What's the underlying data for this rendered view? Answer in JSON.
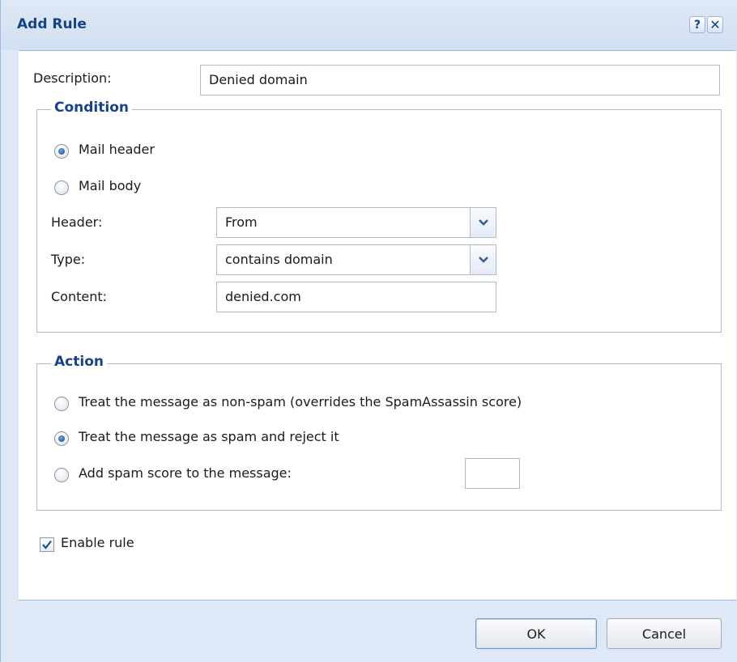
{
  "dialog": {
    "title": "Add Rule",
    "help_glyph": "?",
    "close_glyph": "✕"
  },
  "description": {
    "label": "Description:",
    "value": "Denied domain"
  },
  "condition": {
    "legend": "Condition",
    "options": [
      {
        "label": "Mail header",
        "selected": true
      },
      {
        "label": "Mail body",
        "selected": false
      }
    ],
    "header": {
      "label": "Header:",
      "value": "From"
    },
    "type": {
      "label": "Type:",
      "value": "contains domain"
    },
    "content": {
      "label": "Content:",
      "value": "denied.com"
    }
  },
  "action": {
    "legend": "Action",
    "options": [
      {
        "label": "Treat the message as non-spam (overrides the SpamAssassin score)",
        "selected": false
      },
      {
        "label": "Treat the message as spam and reject it",
        "selected": true
      },
      {
        "label": "Add spam score to the message:",
        "selected": false
      }
    ],
    "spam_score_value": ""
  },
  "enable_rule": {
    "label": "Enable rule",
    "checked": true
  },
  "buttons": {
    "ok_label": "OK",
    "cancel_label": "Cancel"
  },
  "colors": {
    "window_bg": "#dfe8f6",
    "title_text": "#15428b",
    "legend_text": "#15428b",
    "border": "#b5b8c8"
  },
  "icons": {
    "help": "help-icon",
    "close": "close-icon",
    "dropdown": "chevron-down-icon",
    "check": "check-icon"
  }
}
